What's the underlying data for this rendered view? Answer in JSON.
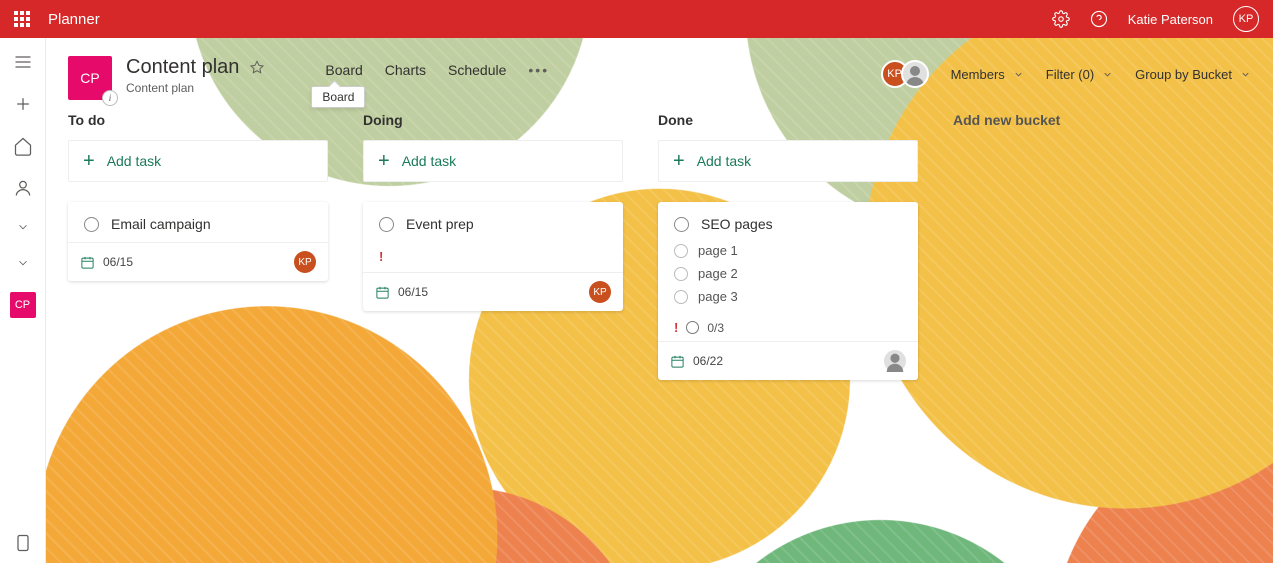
{
  "app": {
    "name": "Planner"
  },
  "user": {
    "name": "Katie Paterson",
    "initials": "KP"
  },
  "rail": {
    "tile_initials": "CP"
  },
  "plan": {
    "tile_initials": "CP",
    "title": "Content plan",
    "subtitle": "Content plan"
  },
  "views": {
    "board": "Board",
    "charts": "Charts",
    "schedule": "Schedule",
    "tooltip": "Board"
  },
  "controls": {
    "members": "Members",
    "filter": "Filter (0)",
    "group": "Group by Bucket"
  },
  "avatars": {
    "kp": "KP"
  },
  "add_task_label": "Add task",
  "buckets": {
    "new_label": "Add new bucket",
    "todo": {
      "title": "To do"
    },
    "doing": {
      "title": "Doing"
    },
    "done": {
      "title": "Done"
    }
  },
  "cards": {
    "email": {
      "title": "Email campaign",
      "date": "06/15",
      "assignee": "KP"
    },
    "event": {
      "title": "Event prep",
      "date": "06/15",
      "assignee": "KP"
    },
    "seo": {
      "title": "SEO pages",
      "sub1": "page 1",
      "sub2": "page 2",
      "sub3": "page 3",
      "progress": "0/3",
      "date": "06/22"
    }
  }
}
